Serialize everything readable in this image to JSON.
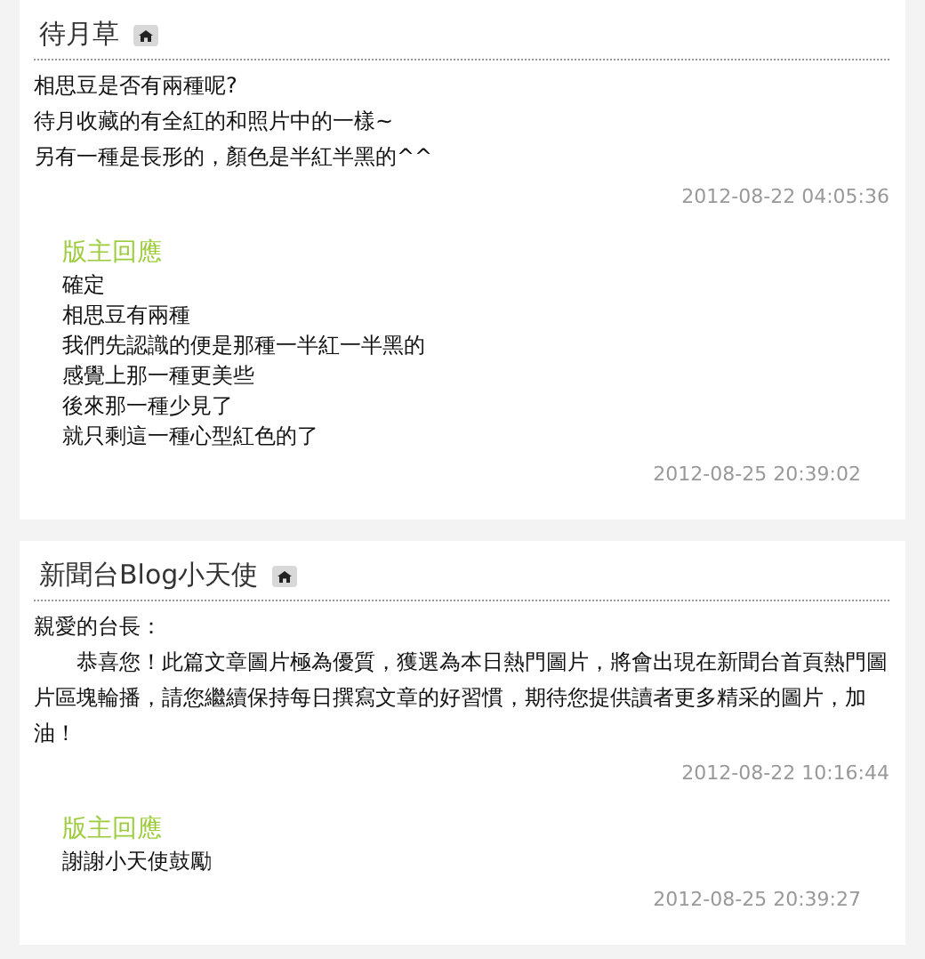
{
  "comments": [
    {
      "author": "待月草",
      "body": [
        "相思豆是否有兩種呢?",
        "待月收藏的有全紅的和照片中的一樣~",
        "另有一種是長形的，顏色是半紅半黑的^^"
      ],
      "time": "2012-08-22 04:05:36",
      "reply": {
        "title": "版主回應",
        "lines": [
          "確定",
          "相思豆有兩種",
          "我們先認識的便是那種一半紅一半黑的",
          "感覺上那一種更美些",
          "後來那一種少見了",
          "就只剩這一種心型紅色的了"
        ],
        "time": "2012-08-25 20:39:02"
      }
    },
    {
      "author": "新聞台Blog小天使",
      "body": [
        "親愛的台長：",
        "　　恭喜您！此篇文章圖片極為優質，獲選為本日熱門圖片，將會出現在新聞台首頁熱門圖片區塊輪播，請您繼續保持每日撰寫文章的好習慣，期待您提供讀者更多精采的圖片，加油！"
      ],
      "time": "2012-08-22 10:16:44",
      "reply": {
        "title": "版主回應",
        "lines": [
          "謝謝小天使鼓勵"
        ],
        "time": "2012-08-25 20:39:27"
      }
    }
  ]
}
